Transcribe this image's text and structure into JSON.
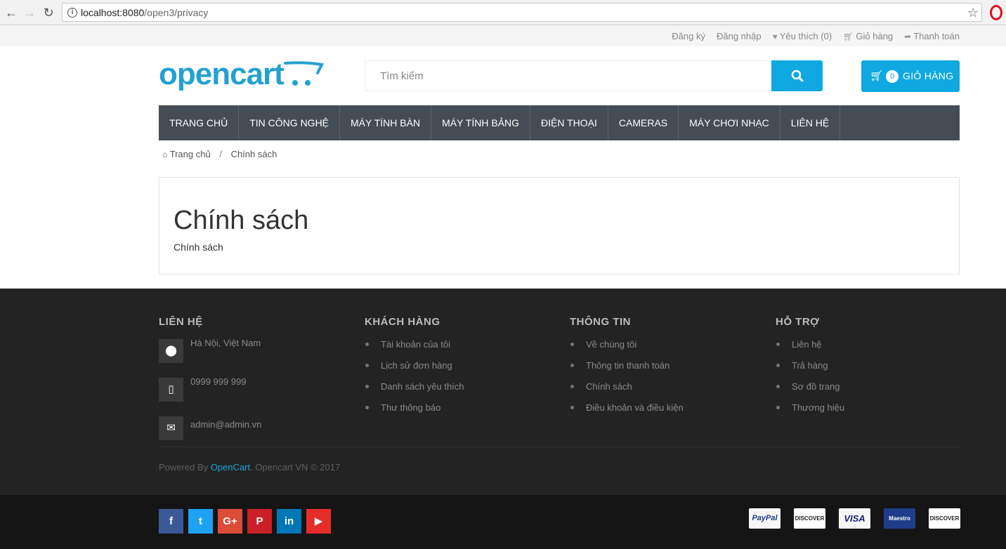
{
  "browser": {
    "url_host": "localhost:8080",
    "url_path": "/open3/privacy"
  },
  "toplinks": {
    "register": "Đăng ký",
    "login": "Đăng nhập",
    "wishlist": "Yêu thích (0)",
    "cart": "Giỏ hàng",
    "checkout": "Thanh toán"
  },
  "logo": {
    "text": "opencart"
  },
  "search": {
    "placeholder": "Tìm kiếm"
  },
  "cart": {
    "count": "0",
    "label": "GIỎ HÀNG"
  },
  "menu": [
    "TRANG CHỦ",
    "TIN CÔNG NGHỆ",
    "MÁY TÍNH BÀN",
    "MÁY TÍNH BẢNG",
    "ĐIỆN THOẠI",
    "CAMERAS",
    "MÁY CHƠI NHẠC",
    "LIÊN HỆ"
  ],
  "breadcrumb": {
    "home": "Trang chủ",
    "current": "Chính sách"
  },
  "page": {
    "title": "Chính sách",
    "body": "Chính sách"
  },
  "footer": {
    "contact": {
      "heading": "LIÊN HỆ",
      "address": "Hà Nội, Việt Nam",
      "phone": "0999 999 999",
      "email": "admin@admin.vn"
    },
    "customer": {
      "heading": "KHÁCH HÀNG",
      "links": [
        "Tài khoản của tôi",
        "Lịch sử đơn hàng",
        "Danh sách yêu thích",
        "Thư thông báo"
      ]
    },
    "info": {
      "heading": "THÔNG TIN",
      "links": [
        "Về chúng tôi",
        "Thông tin thanh toán",
        "Chính sách",
        "Điều khoản và điều kiện"
      ]
    },
    "support": {
      "heading": "HỖ TRỢ",
      "links": [
        "Liên hệ",
        "Trả hàng",
        "Sơ đồ trang",
        "Thương hiệu"
      ]
    },
    "powered_prefix": "Powered By ",
    "powered_brand": "OpenCart",
    "powered_suffix": ". Opencart VN © 2017"
  },
  "social": [
    {
      "icon": "facebook-icon",
      "glyph": "f",
      "color": "#3b5998"
    },
    {
      "icon": "twitter-icon",
      "glyph": "t",
      "color": "#1da1f2"
    },
    {
      "icon": "google-plus-icon",
      "glyph": "G+",
      "color": "#dd4b39"
    },
    {
      "icon": "pinterest-icon",
      "glyph": "P",
      "color": "#cb2027"
    },
    {
      "icon": "linkedin-icon",
      "glyph": "in",
      "color": "#0077b5"
    },
    {
      "icon": "youtube-icon",
      "glyph": "▶",
      "color": "#e52d27"
    }
  ],
  "payments": {
    "paypal": "PayPal",
    "discover": "DISCOVER",
    "visa": "VISA",
    "maestro": "Maestro",
    "discover2": "DISCOVER"
  }
}
